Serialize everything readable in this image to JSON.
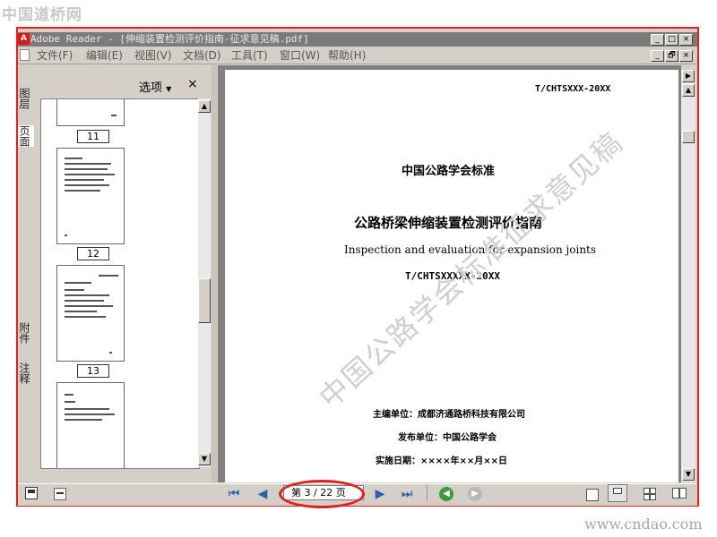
{
  "site": {
    "logo": "中国道桥网",
    "url": "www.cndao.com"
  },
  "window": {
    "app_title": "Adobe Reader - [伸缩装置检测评价指南-征求意见稿.pdf]",
    "controls": [
      "_",
      "□",
      "×"
    ],
    "doc_controls": [
      "_",
      "🗗",
      "×"
    ]
  },
  "menu": {
    "items": [
      "文件(F)",
      "编辑(E)",
      "视图(V)",
      "文档(D)",
      "工具(T)",
      "窗口(W)",
      "帮助(H)"
    ]
  },
  "left_tabs": {
    "layers": "图层",
    "pages": "页面",
    "attachments": "附件",
    "comments": "注释"
  },
  "thumbnail_panel": {
    "options_label": "选项",
    "close_label": "×",
    "page_numbers": [
      "11",
      "12",
      "13"
    ]
  },
  "document": {
    "header_code": "T/CHTSXXX-20XX",
    "org_standard": "中国公路学会标准",
    "title_cn": "公路桥梁伸缩装置检测评价指南",
    "title_en": "Inspection and evaluation for expansion joints",
    "code": "T/CHTSXXXXX-20XX",
    "editor": "主编单位：成都济通路桥科技有限公司",
    "publisher": "发布单位：中国公路学会",
    "effective_date": "实施日期：××××年××月××日",
    "watermark": "中国公路学会标准征求意见稿"
  },
  "navigation": {
    "page_indicator": "第 3 / 22 页",
    "current_page": 3,
    "total_pages": 22
  },
  "colors": {
    "highlight": "#ee1c1c",
    "window_bg": "#d4d0c8",
    "nav_blue": "#2a5fb0",
    "nav_green": "#3c9a3c"
  }
}
